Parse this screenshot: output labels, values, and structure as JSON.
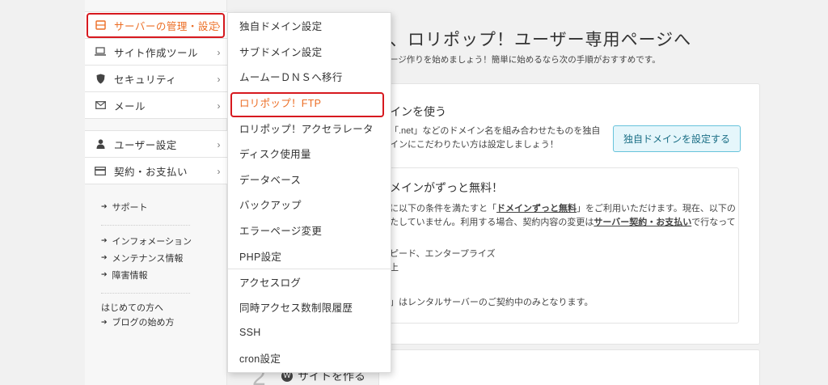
{
  "sidebar": {
    "group1": [
      {
        "label": "サーバーの管理・設定",
        "icon": "server-icon",
        "active": true
      },
      {
        "label": "サイト作成ツール",
        "icon": "laptop-icon"
      },
      {
        "label": "セキュリティ",
        "icon": "shield-icon"
      },
      {
        "label": "メール",
        "icon": "mail-icon"
      }
    ],
    "group2": [
      {
        "label": "ユーザー設定",
        "icon": "user-icon"
      },
      {
        "label": "契約・お支払い",
        "icon": "card-icon"
      }
    ],
    "links": {
      "support": "サポート",
      "info": "インフォメーション",
      "maintenance": "メンテナンス情報",
      "incidents": "障害情報",
      "beginners": "はじめての方へ",
      "blog_start": "ブログの始め方"
    }
  },
  "main": {
    "headline": "、ロリポップ！ユーザー専用ページへ",
    "subline": "ージ作りを始めましょう！簡単に始めるなら次の手順がおすすめです。",
    "domain_title": "インを使う",
    "domain_body_1": "「.net」などのドメイン名を組み合わせたものを独自",
    "domain_body_2": "インにこだわりたい方は設定しましょう！",
    "domain_button": "独自ドメインを設定する",
    "free_title": "メインがずっと無料！",
    "free_body_1_a": "に以下の条件を満たすと「",
    "free_body_1_b": "ドメインずっと無料",
    "free_body_1_c": "」をご利用いただけます。現在、以下の",
    "free_body_2_a": "たしていません。利用する場合、契約内容の変更は",
    "free_body_2_b": "サーバー契約・お支払い",
    "free_body_2_c": "で行なって",
    "plans": "ピード、エンタープライズ",
    "plans_2": "上",
    "note": "」はレンタルサーバーのご契約中のみとなります。",
    "step_number": "2",
    "step_title": "サイトを作る"
  },
  "dropdown": {
    "items": [
      {
        "label": "独自ドメイン設定"
      },
      {
        "label": "サブドメイン設定"
      },
      {
        "label": "ムームーＤＮＳへ移行"
      },
      {
        "label": "ロリポップ！FTP",
        "highlighted": true
      },
      {
        "label": "ロリポップ！アクセラレータ"
      },
      {
        "label": "ディスク使用量"
      },
      {
        "label": "データベース"
      },
      {
        "label": "バックアップ"
      },
      {
        "label": "エラーページ変更"
      },
      {
        "label": "PHP設定"
      },
      {
        "label": "アクセスログ",
        "separator_before": true
      },
      {
        "label": "同時アクセス数制限履歴"
      },
      {
        "label": "SSH"
      },
      {
        "label": "cron設定"
      }
    ]
  },
  "colors": {
    "accent": "#ec6d24",
    "highlight_ring": "#d7191f",
    "button_bg": "#e5f6fb",
    "button_border": "#67c3db"
  }
}
